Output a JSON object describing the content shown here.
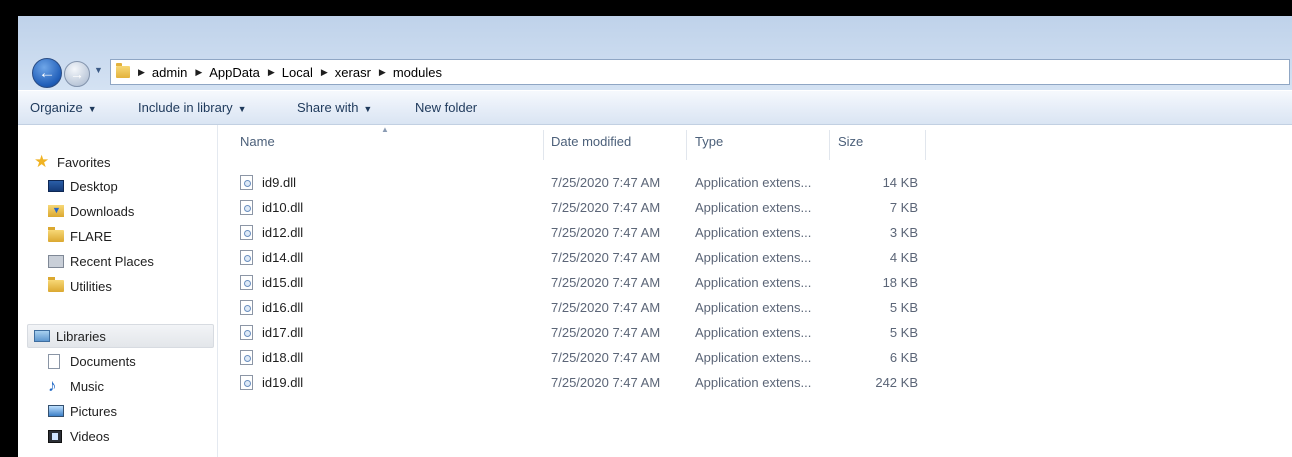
{
  "address": {
    "crumbs": [
      "admin",
      "AppData",
      "Local",
      "xerasr",
      "modules"
    ]
  },
  "toolbar": {
    "organize": "Organize",
    "include_in_library": "Include in library",
    "share_with": "Share with",
    "new_folder": "New folder"
  },
  "nav": {
    "favorites": "Favorites",
    "desktop": "Desktop",
    "downloads": "Downloads",
    "flare": "FLARE",
    "recent_places": "Recent Places",
    "utilities": "Utilities",
    "libraries": "Libraries",
    "documents": "Documents",
    "music": "Music",
    "pictures": "Pictures",
    "videos": "Videos"
  },
  "columns": {
    "name": "Name",
    "date_modified": "Date modified",
    "type": "Type",
    "size": "Size"
  },
  "files": [
    {
      "name": "id9.dll",
      "date": "7/25/2020 7:47 AM",
      "type": "Application extens...",
      "size": "14 KB"
    },
    {
      "name": "id10.dll",
      "date": "7/25/2020 7:47 AM",
      "type": "Application extens...",
      "size": "7 KB"
    },
    {
      "name": "id12.dll",
      "date": "7/25/2020 7:47 AM",
      "type": "Application extens...",
      "size": "3 KB"
    },
    {
      "name": "id14.dll",
      "date": "7/25/2020 7:47 AM",
      "type": "Application extens...",
      "size": "4 KB"
    },
    {
      "name": "id15.dll",
      "date": "7/25/2020 7:47 AM",
      "type": "Application extens...",
      "size": "18 KB"
    },
    {
      "name": "id16.dll",
      "date": "7/25/2020 7:47 AM",
      "type": "Application extens...",
      "size": "5 KB"
    },
    {
      "name": "id17.dll",
      "date": "7/25/2020 7:47 AM",
      "type": "Application extens...",
      "size": "5 KB"
    },
    {
      "name": "id18.dll",
      "date": "7/25/2020 7:47 AM",
      "type": "Application extens...",
      "size": "6 KB"
    },
    {
      "name": "id19.dll",
      "date": "7/25/2020 7:47 AM",
      "type": "Application extens...",
      "size": "242 KB"
    }
  ],
  "icons": {
    "back": "back-arrow-icon",
    "forward": "forward-arrow-icon",
    "file": "dll-file-icon"
  },
  "colors": {
    "chrome": "#c8d9ee",
    "toolbar_text": "#1e395b",
    "back_button": "#1f5db8"
  }
}
